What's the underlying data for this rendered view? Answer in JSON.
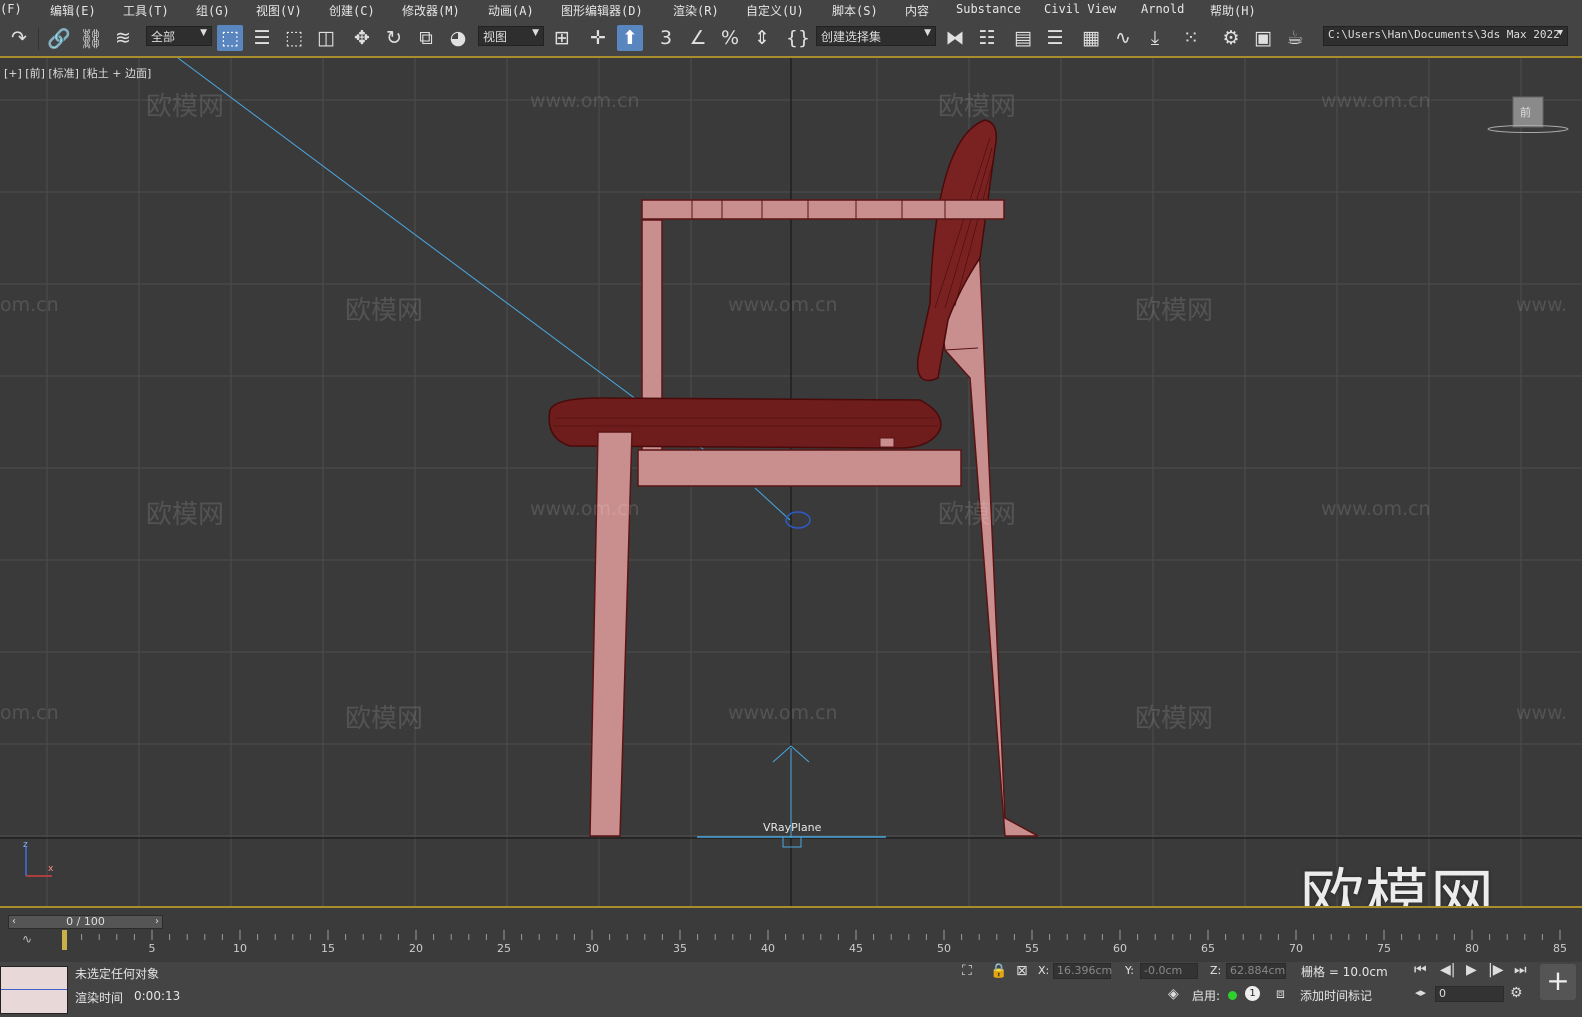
{
  "menu": [
    {
      "id": "file",
      "label": "(F)"
    },
    {
      "id": "edit",
      "label": "编辑(E)"
    },
    {
      "id": "tools",
      "label": "工具(T)"
    },
    {
      "id": "group",
      "label": "组(G)"
    },
    {
      "id": "views",
      "label": "视图(V)"
    },
    {
      "id": "create",
      "label": "创建(C)"
    },
    {
      "id": "modifiers",
      "label": "修改器(M)"
    },
    {
      "id": "animation",
      "label": "动画(A)"
    },
    {
      "id": "graph",
      "label": "图形编辑器(D)"
    },
    {
      "id": "rendering",
      "label": "渲染(R)"
    },
    {
      "id": "customize",
      "label": "自定义(U)"
    },
    {
      "id": "scripting",
      "label": "脚本(S)"
    },
    {
      "id": "content",
      "label": "内容"
    },
    {
      "id": "substance",
      "label": "Substance"
    },
    {
      "id": "civilview",
      "label": "Civil View"
    },
    {
      "id": "arnold",
      "label": "Arnold"
    },
    {
      "id": "help",
      "label": "帮助(H)"
    }
  ],
  "toolbar": {
    "selection_filter": "全部",
    "ref_coord": "视图",
    "named_selection": "创建选择集",
    "project_path": "C:\\Users\\Han\\Documents\\3ds Max 2022",
    "snap_number": "3"
  },
  "viewport": {
    "label": "[+] [前] [标准] [粘土 + 边面]",
    "object_label": "VRayPlane",
    "viewcube_text": "前",
    "big_watermark": "欧模网",
    "watermark_cn": "欧模网",
    "watermark_url": "www.om.cn",
    "watermark_url_partial": "om.cn",
    "watermark_url_cut": "www.",
    "axis_z": "z",
    "axis_x": "x"
  },
  "timeline": {
    "slider_text": "0 / 100",
    "ticks": [
      "5",
      "10",
      "15",
      "20",
      "25",
      "30",
      "35",
      "40",
      "45",
      "50",
      "55",
      "60",
      "65",
      "70",
      "75",
      "80",
      "85"
    ],
    "current_frame": 0
  },
  "status": {
    "selection": "未选定任何对象",
    "render_time_label": "渲染时间",
    "render_time": "0:00:13",
    "x_label": "X:",
    "x_value": "16.396cm",
    "y_label": "Y:",
    "y_value": "-0.0cm",
    "z_label": "Z:",
    "z_value": "62.884cm",
    "grid": "栅格 = 10.0cm",
    "enable_label": "启用:",
    "badge": "1",
    "add_tag": "添加时间标记",
    "frame_value": "0"
  },
  "colors": {
    "chair_fill": "#c98e8e",
    "chair_dark": "#5a1414",
    "accent": "#a88d2a"
  }
}
